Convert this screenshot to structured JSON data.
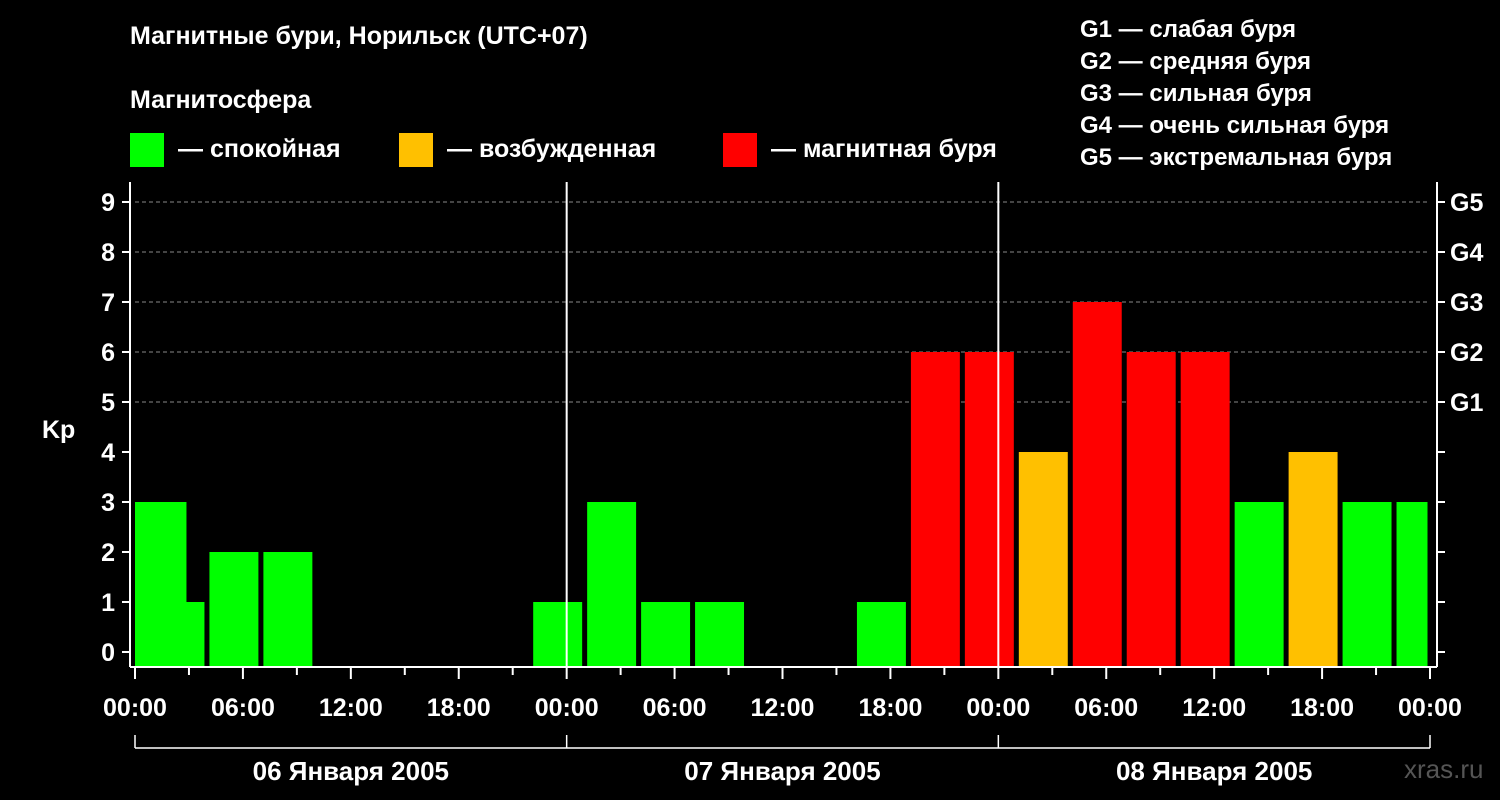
{
  "title": "Магнитные бури, Норильск (UTC+07)",
  "subtitle": "Магнитосфера",
  "legend": [
    {
      "label": "— спокойная",
      "color": "#00ff00"
    },
    {
      "label": "— возбужденная",
      "color": "#ffc000"
    },
    {
      "label": "— магнитная буря",
      "color": "#ff0000"
    }
  ],
  "storm_scale": [
    "G1 — слабая буря",
    "G2 — средняя буря",
    "G3 — сильная буря",
    "G4 — очень сильная буря",
    "G5 — экстремальная буря"
  ],
  "watermark": "xras.ru",
  "chart_data": {
    "type": "bar",
    "ylabel": "Kp",
    "ylim": [
      0,
      9
    ],
    "yticks": [
      0,
      1,
      2,
      3,
      4,
      5,
      6,
      7,
      8,
      9
    ],
    "right_axis_labels": [
      {
        "kp": 5,
        "label": "G1"
      },
      {
        "kp": 6,
        "label": "G2"
      },
      {
        "kp": 7,
        "label": "G3"
      },
      {
        "kp": 8,
        "label": "G4"
      },
      {
        "kp": 9,
        "label": "G5"
      }
    ],
    "x_tick_labels": [
      "00:00",
      "06:00",
      "12:00",
      "18:00",
      "00:00",
      "06:00",
      "12:00",
      "18:00",
      "00:00",
      "06:00",
      "12:00",
      "18:00",
      "00:00"
    ],
    "days": [
      "06 Января 2005",
      "07 Января 2005",
      "08 Января 2005"
    ],
    "grid": "dashed horizontal at 5–9",
    "bar_hours": 3,
    "series": [
      {
        "values": [
          {
            "start_hour": 0,
            "kp": 3,
            "status": "quiet"
          },
          {
            "start_hour": 1,
            "kp": 1,
            "status": "quiet"
          },
          {
            "start_hour": 4,
            "kp": 2,
            "status": "quiet"
          },
          {
            "start_hour": 7,
            "kp": 2,
            "status": "quiet"
          },
          {
            "start_hour": 10,
            "kp": 0,
            "status": "quiet"
          },
          {
            "start_hour": 13,
            "kp": 0,
            "status": "quiet"
          },
          {
            "start_hour": 16,
            "kp": 0,
            "status": "quiet"
          },
          {
            "start_hour": 19,
            "kp": 0,
            "status": "quiet"
          },
          {
            "start_hour": 22,
            "kp": 1,
            "status": "quiet"
          },
          {
            "start_hour": 25,
            "kp": 3,
            "status": "quiet"
          },
          {
            "start_hour": 28,
            "kp": 1,
            "status": "quiet"
          },
          {
            "start_hour": 31,
            "kp": 1,
            "status": "quiet"
          },
          {
            "start_hour": 34,
            "kp": 0,
            "status": "quiet"
          },
          {
            "start_hour": 37,
            "kp": 0,
            "status": "quiet"
          },
          {
            "start_hour": 40,
            "kp": 1,
            "status": "quiet"
          },
          {
            "start_hour": 43,
            "kp": 6,
            "status": "storm"
          },
          {
            "start_hour": 46,
            "kp": 6,
            "status": "storm"
          },
          {
            "start_hour": 49,
            "kp": 4,
            "status": "active"
          },
          {
            "start_hour": 52,
            "kp": 7,
            "status": "storm"
          },
          {
            "start_hour": 55,
            "kp": 6,
            "status": "storm"
          },
          {
            "start_hour": 58,
            "kp": 6,
            "status": "storm"
          },
          {
            "start_hour": 61,
            "kp": 3,
            "status": "quiet"
          },
          {
            "start_hour": 64,
            "kp": 4,
            "status": "active"
          },
          {
            "start_hour": 67,
            "kp": 3,
            "status": "quiet"
          },
          {
            "start_hour": 70,
            "kp": 3,
            "status": "quiet"
          }
        ]
      }
    ],
    "colors": {
      "quiet": "#00ff00",
      "active": "#ffc000",
      "storm": "#ff0000"
    }
  }
}
